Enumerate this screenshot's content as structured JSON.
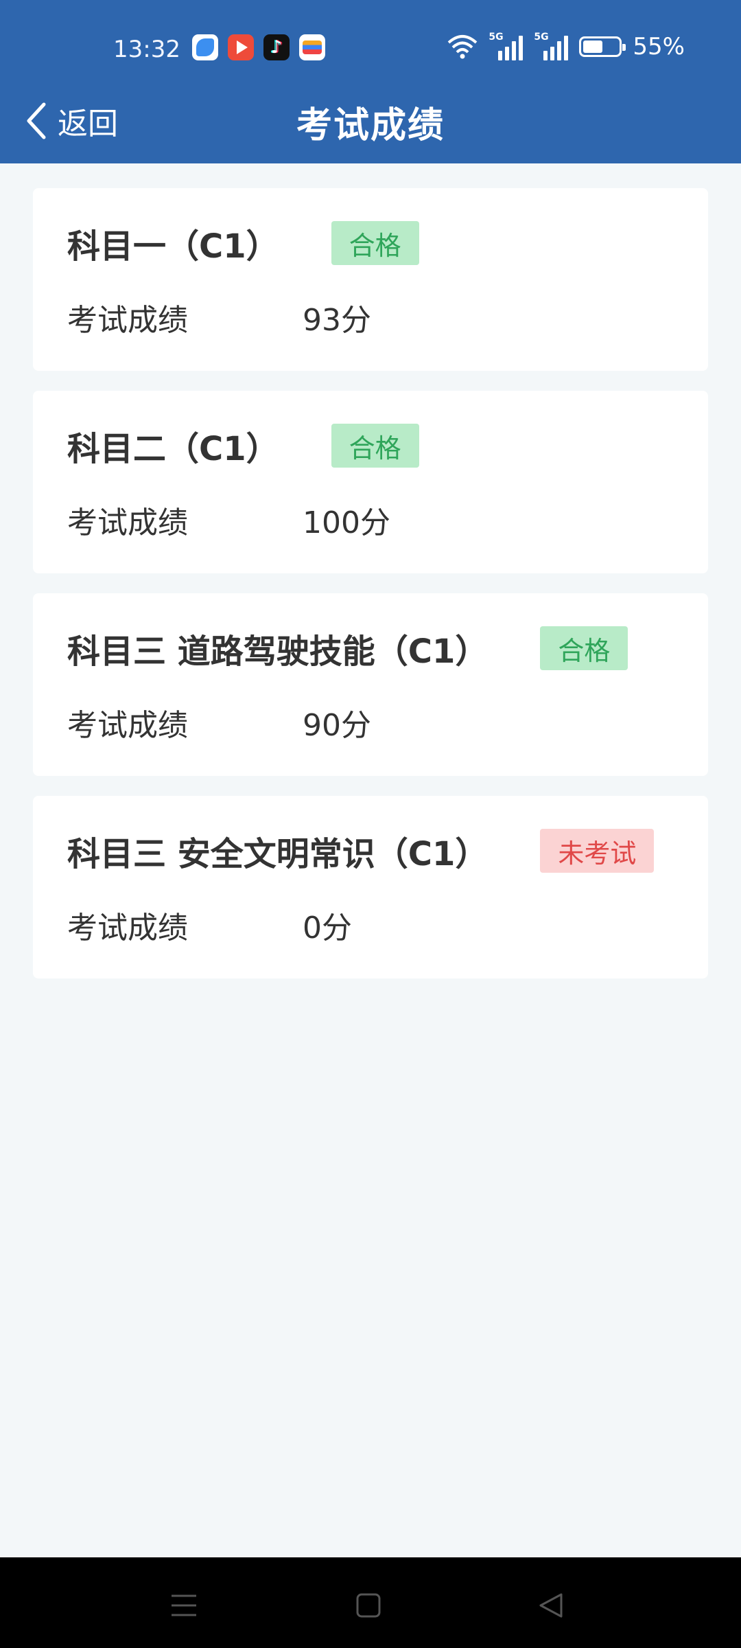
{
  "status_bar": {
    "time": "13:32",
    "network_labels": [
      "5G",
      "5G"
    ],
    "battery_percent": "55%",
    "battery_level": 0.55
  },
  "app_icons": [
    "browser-icon",
    "video-app-icon",
    "tiktok-icon",
    "wallet-icon"
  ],
  "header": {
    "back_label": "返回",
    "title": "考试成绩",
    "background": "#2e66ae"
  },
  "cards": [
    {
      "title": "科目一（C1）",
      "badge": "合格",
      "status": "pass",
      "score_label": "考试成绩",
      "score": "93分"
    },
    {
      "title": "科目二（C1）",
      "badge": "合格",
      "status": "pass",
      "score_label": "考试成绩",
      "score": "100分"
    },
    {
      "title": "科目三 道路驾驶技能（C1）",
      "badge": "合格",
      "status": "pass",
      "score_label": "考试成绩",
      "score": "90分"
    },
    {
      "title": "科目三 安全文明常识（C1）",
      "badge": "未考试",
      "status": "fail",
      "score_label": "考试成绩",
      "score": "0分"
    }
  ],
  "colors": {
    "pass_bg": "#b8ebc8",
    "pass_text": "#2fa55a",
    "fail_bg": "#fbd3d3",
    "fail_text": "#e04848",
    "page_bg": "#f3f7f9"
  },
  "system_nav": [
    "menu-icon",
    "home-icon",
    "back-triangle-icon"
  ]
}
